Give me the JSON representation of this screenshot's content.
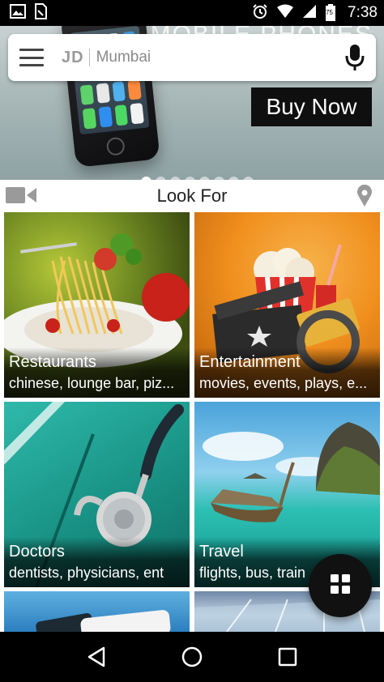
{
  "status_bar": {
    "time": "7:38",
    "battery_level": "75",
    "icons": [
      "image-icon",
      "sim-icon",
      "alarm-icon",
      "wifi-icon",
      "signal-icon",
      "battery-icon"
    ]
  },
  "banner": {
    "brand_text": "MOBILE PHONES",
    "cta_label": "Buy Now",
    "slide_count": 8,
    "active_slide": 1,
    "cta_color": "#0f0f10"
  },
  "search": {
    "logo_text": "JD",
    "city": "Mumbai"
  },
  "look_for": {
    "title": "Look For"
  },
  "categories": [
    {
      "name": "Restaurants",
      "subtitle": "chinese, lounge bar, piz..."
    },
    {
      "name": "Entertainment",
      "subtitle": "movies, events, plays, e..."
    },
    {
      "name": "Doctors",
      "subtitle": "dentists, physicians, ent"
    },
    {
      "name": "Travel",
      "subtitle": "flights, bus, train"
    }
  ],
  "fab": {
    "icon": "grid-icon"
  },
  "nav": {
    "icons": [
      "back-icon",
      "home-icon",
      "recents-icon"
    ]
  }
}
